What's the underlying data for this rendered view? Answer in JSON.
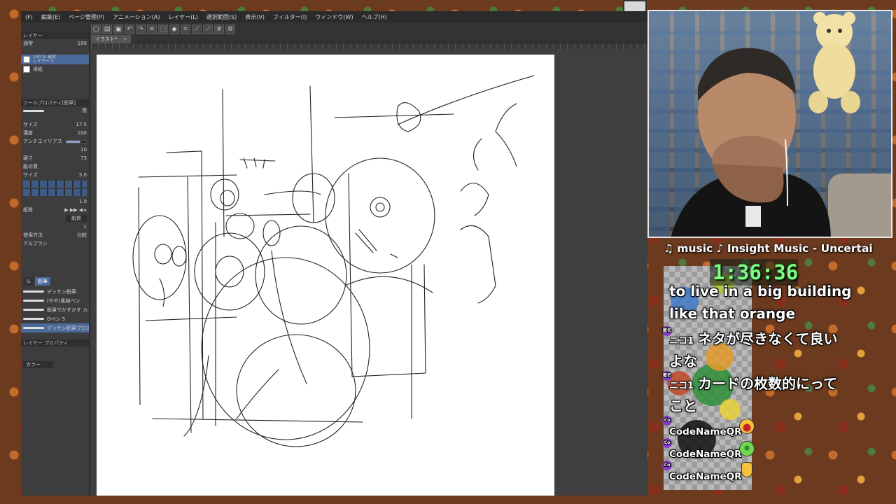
{
  "app": {
    "menu": [
      "(F)",
      "編集(E)",
      "ページ管理(P)",
      "アニメーション(A)",
      "レイヤー(L)",
      "選択範囲(S)",
      "表示(V)",
      "フィルター(I)",
      "ウィンドウ(W)",
      "ヘルプ(H)"
    ],
    "document_tab": "イラスト*",
    "layers_panel": {
      "title": "レイヤー",
      "blend_mode": "通常",
      "opacity": "100",
      "layers": [
        {
          "name": "100 % 通常\nレイヤー 1",
          "active": true
        },
        {
          "name": "用紙",
          "active": false
        }
      ]
    },
    "tool_property": {
      "title": "ツールプロパティ[鉛筆]",
      "brush_label": "用",
      "rows": [
        {
          "label": "サイズ",
          "value": "17.5"
        },
        {
          "label": "濃度",
          "value": "100"
        },
        {
          "label": "アンチエイリアス",
          "value": ""
        },
        {
          "label": "",
          "value": "10"
        },
        {
          "label": "硬さ",
          "value": "73"
        },
        {
          "label": "紙の質",
          "value": ""
        },
        {
          "label": "サイズ",
          "value": "5.0"
        },
        {
          "label": "",
          "value": "1.0"
        },
        {
          "label": "紙質",
          "value": ""
        },
        {
          "label": "",
          "value": "1"
        }
      ],
      "paper_button": "紙質",
      "apply_method_label": "使用方法",
      "apply_method_value": "比較",
      "sub_label": "アルブラシ"
    },
    "sub_tool": {
      "tabs": [
        "ル",
        "鉛筆"
      ],
      "brushes": [
        {
          "name": "デッサン鉛筆"
        },
        {
          "name": "(やや)柔線ペン"
        },
        {
          "name": "鉛筆でかすかす カラー"
        },
        {
          "name": "Gペン 5"
        },
        {
          "name": "デッサン鉛筆プロ(細筆) 用",
          "active": true
        }
      ],
      "footer": "レイヤー プロパティ",
      "color_label": "カラー"
    }
  },
  "overlay": {
    "music": "♫ music ♪ Insight Music - Uncertai",
    "timer": "1:36:36",
    "chat": [
      {
        "text": "to live in a big building"
      },
      {
        "text": "like that orange"
      },
      {
        "prefix": "ニコ1",
        "text": "ネタが尽きなくて良い"
      },
      {
        "text": "よな"
      },
      {
        "prefix": "ニコ1",
        "text": "カードの枚数的にって"
      },
      {
        "text": "こと"
      },
      {
        "name": "CodeNameQR",
        "emoji": "grinning-face-icon"
      },
      {
        "name": "CodeNameQR",
        "emoji": "green-face-icon"
      },
      {
        "name": "CodeNameQR",
        "emoji": "thumbs-up-icon"
      }
    ],
    "badges": [
      "匿名",
      "匿名",
      "Co",
      "Co",
      "Co"
    ]
  },
  "colors": {
    "timer_green": "#7dfc84",
    "layer_highlight": "#4b6a9a",
    "badge_purple": "#8b3fd0"
  }
}
